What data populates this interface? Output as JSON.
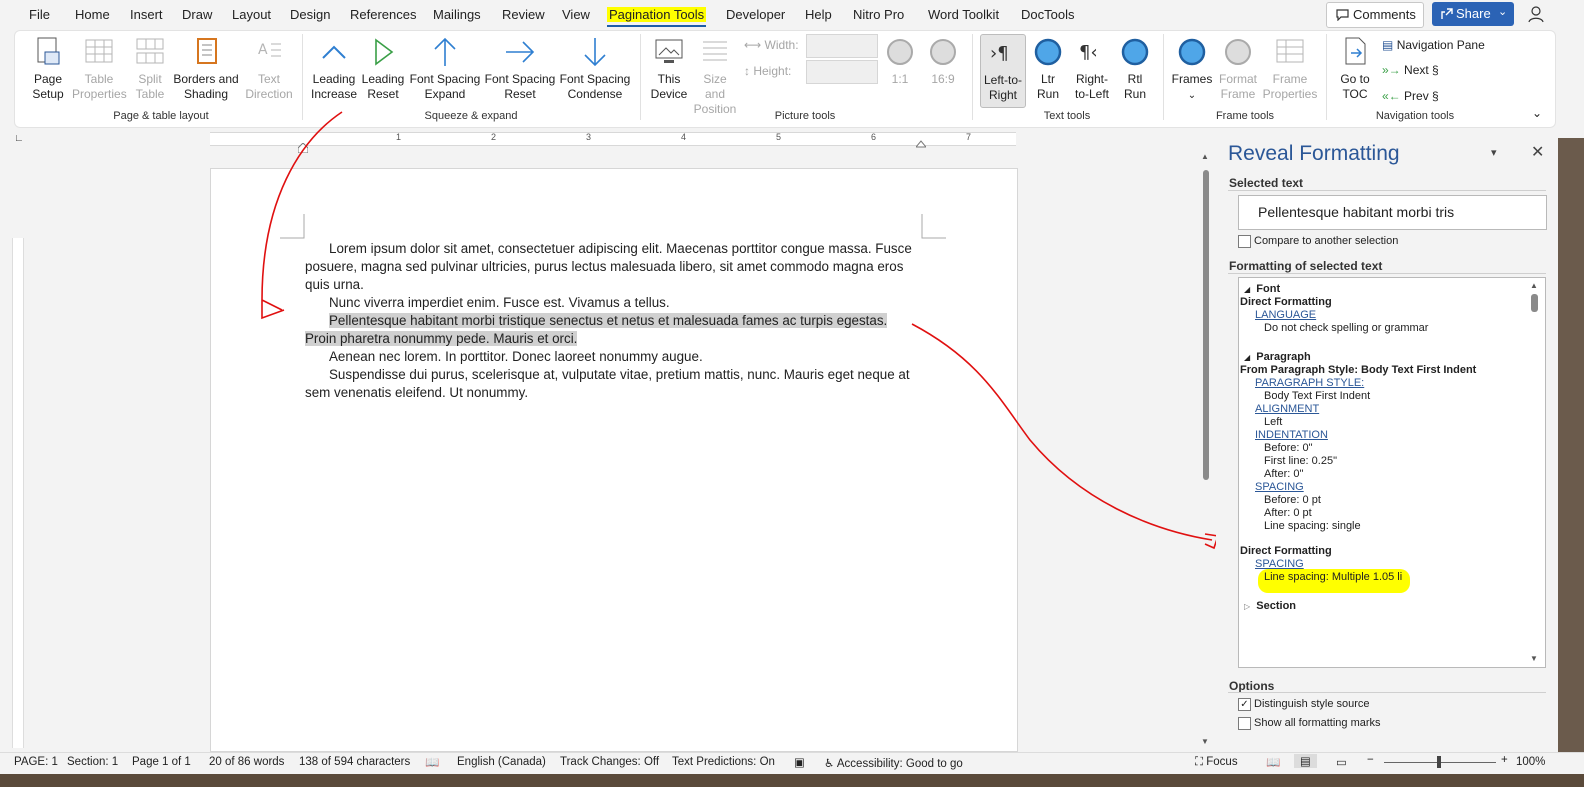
{
  "menubar": {
    "items": [
      "File",
      "Home",
      "Insert",
      "Draw",
      "Layout",
      "Design",
      "References",
      "Mailings",
      "Review",
      "View",
      "Pagination Tools",
      "Developer",
      "Help",
      "Nitro Pro",
      "Word Toolkit",
      "DocTools"
    ],
    "comments_label": "Comments",
    "share_label": "Share"
  },
  "ribbon": {
    "page_table": {
      "group_label": "Page & table layout",
      "page_setup": "Page\nSetup",
      "table_properties": "Table\nProperties",
      "split_table": "Split\nTable",
      "borders_shading": "Borders and\nShading",
      "text_direction": "Text\nDirection"
    },
    "squeeze": {
      "group_label": "Squeeze & expand",
      "leading_increase": "Leading\nIncrease",
      "leading_reset": "Leading\nReset",
      "font_spacing_expand": "Font Spacing\nExpand",
      "font_spacing_reset": "Font Spacing\nReset",
      "font_spacing_condense": "Font Spacing\nCondense"
    },
    "picture": {
      "group_label": "Picture tools",
      "this_device": "This\nDevice",
      "size_position": "Size and\nPosition",
      "width_label": "Width:",
      "height_label": "Height:",
      "ratio_1_1": "1:1",
      "ratio_16_9": "16:9"
    },
    "text_tools": {
      "group_label": "Text tools",
      "left_to_right": "Left-to-\nRight",
      "ltr_run": "Ltr\nRun",
      "right_to_left": "Right-\nto-Left",
      "rtl_run": "Rtl\nRun"
    },
    "frame_tools": {
      "group_label": "Frame tools",
      "frames": "Frames",
      "frame_format": "Format\nFrame",
      "frame_properties": "Frame\nProperties"
    },
    "navigation": {
      "group_label": "Navigation tools",
      "go_to_toc": "Go to\nTOC",
      "navigation_pane": "Navigation Pane",
      "next": "Next §",
      "prev": "Prev §"
    }
  },
  "ruler": {
    "numbers": [
      "1",
      "2",
      "3",
      "4",
      "5",
      "6",
      "7"
    ]
  },
  "document": {
    "para1": "Lorem ipsum dolor sit amet, consectetuer adipiscing elit. Maecenas porttitor congue massa. Fusce posuere, magna sed pulvinar ultricies, purus lectus malesuada libero, sit amet commodo magna eros quis urna.",
    "para2": "Nunc viverra imperdiet enim. Fusce est. Vivamus a tellus.",
    "para3_line1": "Pellentesque habitant morbi tristique senectus et netus et malesuada fames ac turpis egestas.",
    "para3_line2": "Proin pharetra nonummy pede. Mauris et orci.",
    "para4": "Aenean nec lorem. In porttitor. Donec laoreet nonummy augue.",
    "para5": "Suspendisse dui purus, scelerisque at, vulputate vitae, pretium mattis, nunc. Mauris eget neque at sem venenatis eleifend. Ut nonummy."
  },
  "reveal": {
    "title": "Reveal Formatting",
    "selected_text_heading": "Selected text",
    "selected_text": "Pellentesque habitant morbi tris",
    "compare_label": "Compare to another selection",
    "formatting_heading": "Formatting of selected text",
    "tree": {
      "font": "Font",
      "direct_formatting_1": "Direct Formatting",
      "language_link": "LANGUAGE",
      "language_value": "Do not check spelling or grammar",
      "paragraph": "Paragraph",
      "from_style": "From Paragraph Style: Body Text First Indent",
      "paragraph_style_link": "PARAGRAPH STYLE:",
      "paragraph_style_value": "Body Text First Indent",
      "alignment_link": "ALIGNMENT",
      "alignment_value": "Left",
      "indentation_link": "INDENTATION",
      "indent_before": "Before:  0\"",
      "indent_first": "First line:  0.25\"",
      "indent_after": "After:  0\"",
      "spacing_link": "SPACING",
      "spacing_before": "Before:  0 pt",
      "spacing_after": "After:  0 pt",
      "line_spacing": "Line spacing:  single",
      "direct_formatting_2": "Direct Formatting",
      "spacing_link_2": "SPACING",
      "line_spacing_2": "Line spacing:  Multiple 1.05 li",
      "section": "Section"
    },
    "options_heading": "Options",
    "distinguish_label": "Distinguish style source",
    "show_marks_label": "Show all formatting marks"
  },
  "status": {
    "page": "PAGE: 1",
    "section": "Section: 1",
    "page_of": "Page 1 of 1",
    "words": "20 of 86 words",
    "chars": "138 of 594 characters",
    "language": "English (Canada)",
    "track_changes": "Track Changes: Off",
    "text_predictions": "Text Predictions: On",
    "accessibility": "Accessibility: Good to go",
    "focus": "Focus",
    "zoom": "100%"
  },
  "colors": {
    "accent": "#2b5797",
    "share": "#2b63b5",
    "annotation": "#e01010",
    "highlight": "#ffff00"
  }
}
